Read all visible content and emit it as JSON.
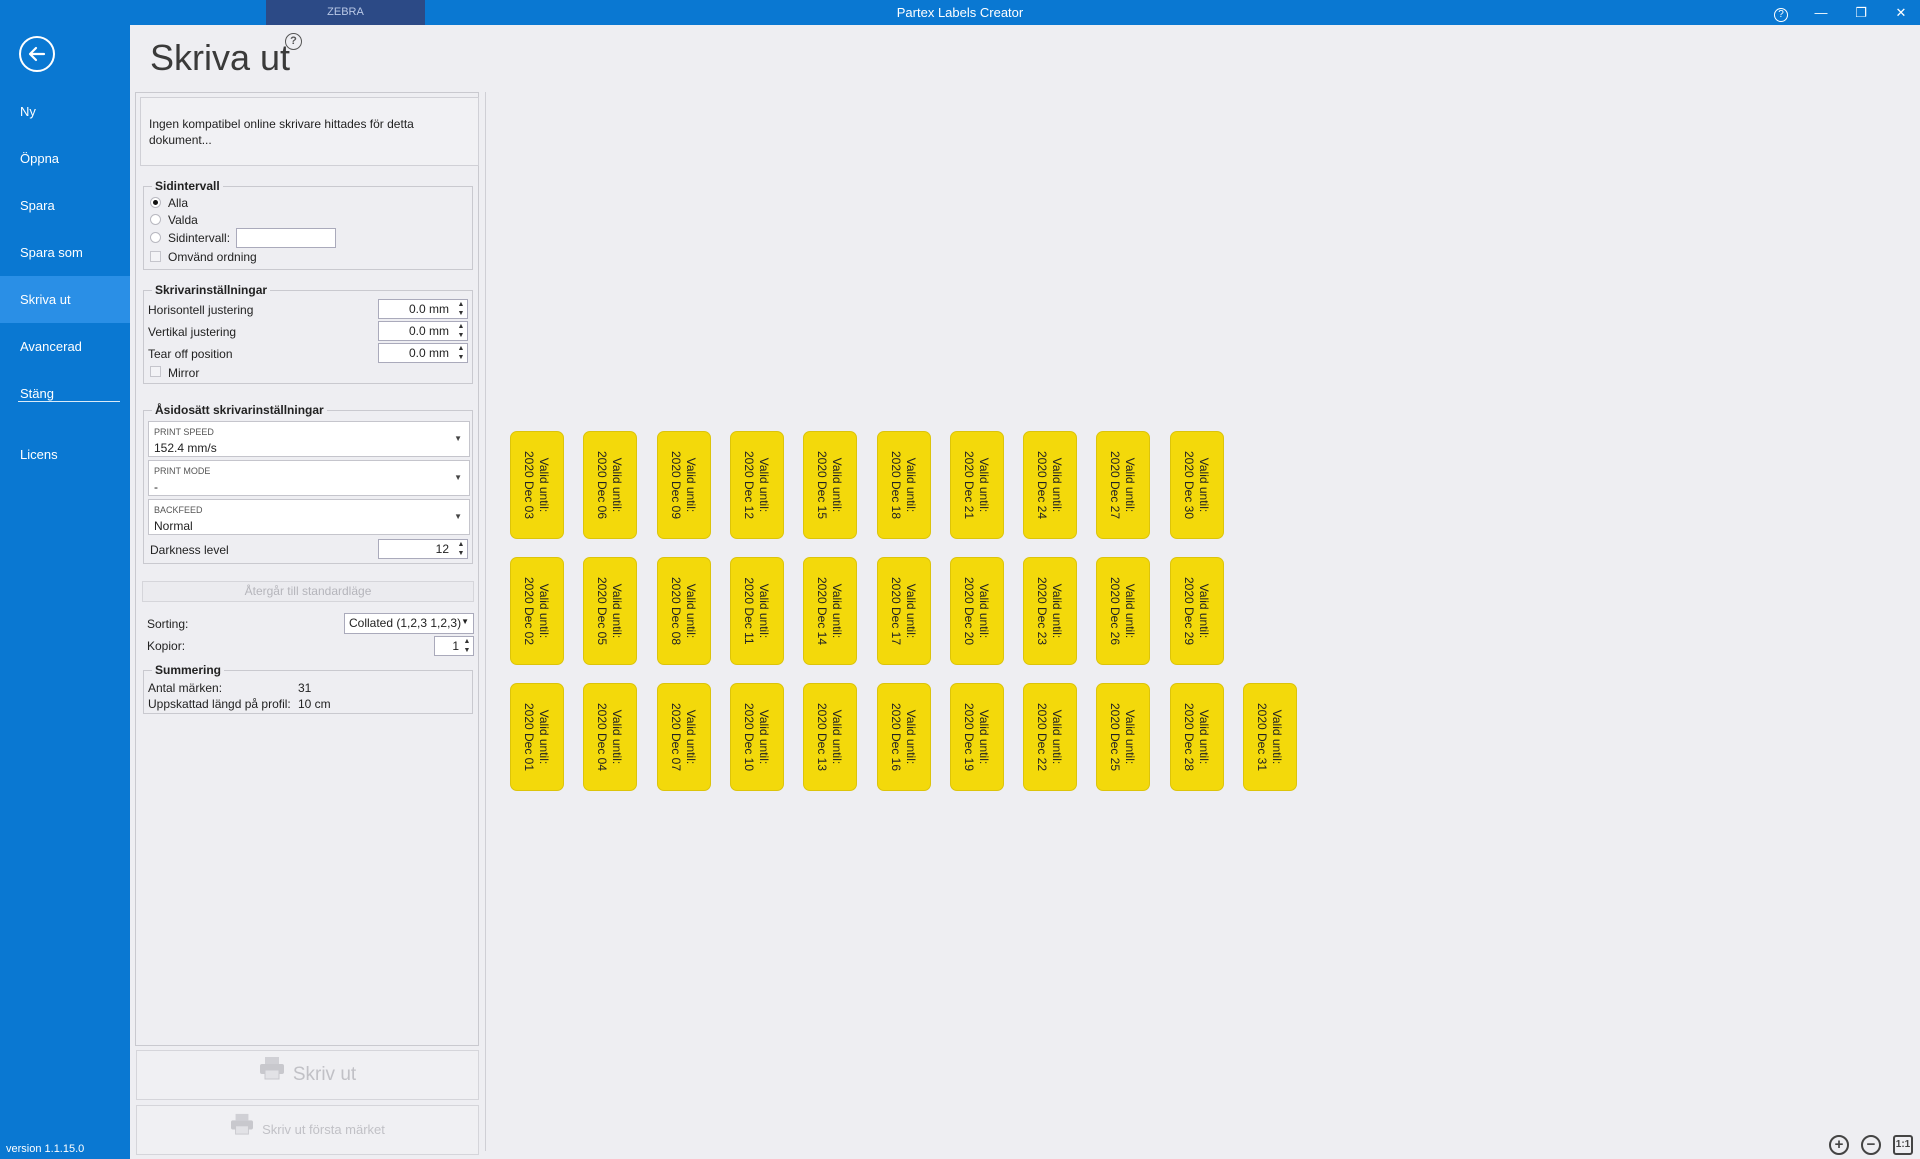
{
  "window": {
    "title": "Partex Labels Creator",
    "tab": "ZEBRA",
    "help": "?",
    "minimize": "—",
    "restore": "❐",
    "close": "✕"
  },
  "sidebar": {
    "items": [
      {
        "label": "Ny"
      },
      {
        "label": "Öppna"
      },
      {
        "label": "Spara"
      },
      {
        "label": "Spara som"
      },
      {
        "label": "Skriva ut"
      },
      {
        "label": "Avancerad"
      },
      {
        "label": "Stäng"
      },
      {
        "label": "Licens"
      }
    ],
    "active": "Skriva ut",
    "version": "version 1.1.15.0"
  },
  "header": {
    "title": "Skriva ut",
    "help": "?"
  },
  "status": {
    "message": "Ingen kompatibel online skrivare hittades för detta dokument..."
  },
  "page_range": {
    "title": "Sidintervall",
    "all": "Alla",
    "selected": "Valda",
    "range": "Sidintervall:",
    "range_value": "",
    "reverse": "Omvänd ordning",
    "selection": "Alla"
  },
  "printer_settings": {
    "title": "Skrivarinställningar",
    "horizontal": {
      "label": "Horisontell justering",
      "value": "0.0 mm"
    },
    "vertical": {
      "label": "Vertikal justering",
      "value": "0.0 mm"
    },
    "tearoff": {
      "label": "Tear off position",
      "value": "0.0 mm"
    },
    "mirror": "Mirror"
  },
  "override": {
    "title": "Åsidosätt skrivarinställningar",
    "print_speed": {
      "label": "PRINT SPEED",
      "value": "152.4 mm/s"
    },
    "print_mode": {
      "label": "PRINT MODE",
      "value": "-"
    },
    "backfeed": {
      "label": "BACKFEED",
      "value": "Normal"
    },
    "darkness": {
      "label": "Darkness level",
      "value": "12"
    }
  },
  "reset_label": "Återgår till standardläge",
  "sorting": {
    "label": "Sorting:",
    "value": "Collated (1,2,3 1,2,3)"
  },
  "copies": {
    "label": "Kopior:",
    "value": "1"
  },
  "summary": {
    "title": "Summering",
    "count_label": "Antal märken:",
    "count_value": "31",
    "length_label": "Uppskattad längd på profil:",
    "length_value": "10 cm"
  },
  "buttons": {
    "print": "Skriv ut",
    "print_first": "Skriv ut första märket"
  },
  "labels": {
    "prefix": "Valid until:",
    "rows": [
      [
        "2020 Dec 03",
        "2020 Dec 06",
        "2020 Dec 09",
        "2020 Dec 12",
        "2020 Dec 15",
        "2020 Dec 18",
        "2020 Dec 21",
        "2020 Dec 24",
        "2020 Dec 27",
        "2020 Dec 30"
      ],
      [
        "2020 Dec 02",
        "2020 Dec 05",
        "2020 Dec 08",
        "2020 Dec 11",
        "2020 Dec 14",
        "2020 Dec 17",
        "2020 Dec 20",
        "2020 Dec 23",
        "2020 Dec 26",
        "2020 Dec 29"
      ],
      [
        "2020 Dec 01",
        "2020 Dec 04",
        "2020 Dec 07",
        "2020 Dec 10",
        "2020 Dec 13",
        "2020 Dec 16",
        "2020 Dec 19",
        "2020 Dec 22",
        "2020 Dec 25",
        "2020 Dec 28",
        "2020 Dec 31"
      ]
    ]
  },
  "zoom": {
    "in": "+",
    "out": "−",
    "fit": "1:1"
  }
}
